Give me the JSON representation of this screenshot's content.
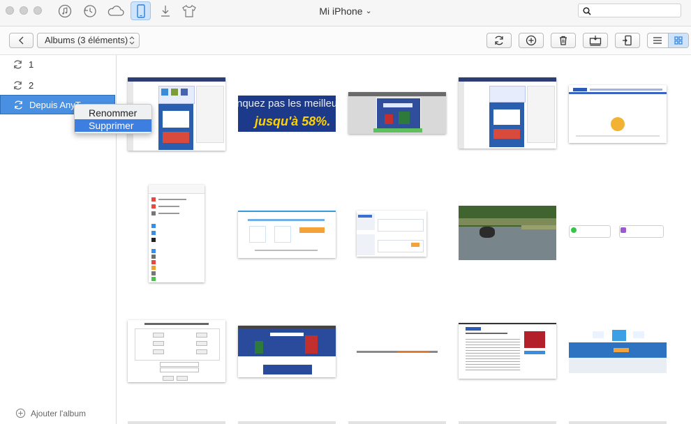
{
  "window": {
    "title": "Mi iPhone",
    "title_caret": "⌄"
  },
  "search": {
    "placeholder": "",
    "value": ""
  },
  "toolbar": {
    "album_select": "Albums (3 éléments)",
    "album_select_chevron": "⌃⌄"
  },
  "sidebar": {
    "albums": [
      {
        "label": "1"
      },
      {
        "label": "2"
      },
      {
        "label": "Depuis AnyT"
      }
    ],
    "add_album_label": "Ajouter l'album"
  },
  "context_menu": {
    "items": [
      {
        "label": "Renommer"
      },
      {
        "label": "Supprimer"
      }
    ]
  },
  "banner": {
    "line1": "nquez pas les meilleu",
    "line2": "jusqu'à 58%."
  },
  "colors": {
    "accent": "#4a90e2",
    "menu_highlight": "#3d7fe0",
    "banner_bg": "#1d3a8a",
    "banner_text": "#ffd200"
  }
}
